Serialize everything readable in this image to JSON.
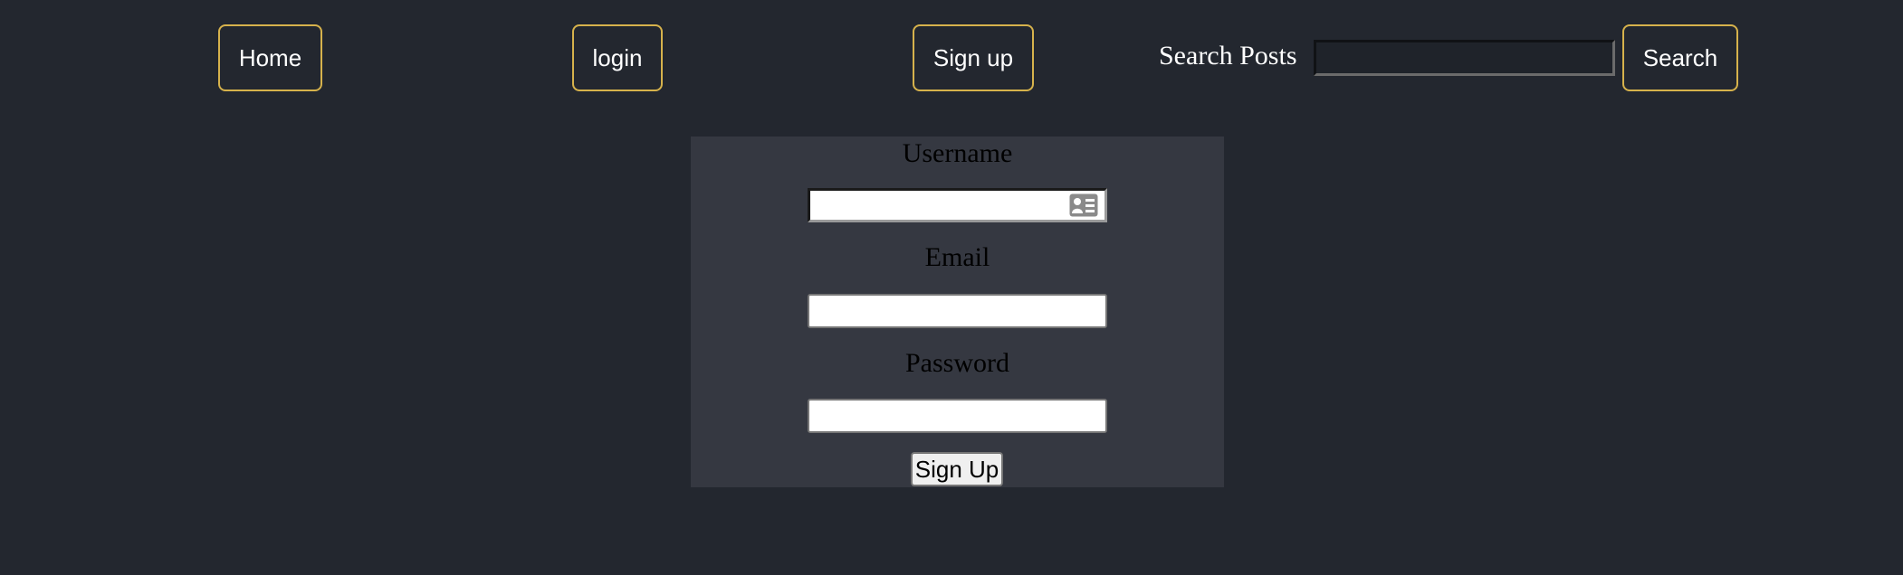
{
  "nav": {
    "home_label": "Home",
    "login_label": "login",
    "signup_label": "Sign up",
    "search_label": "Search Posts",
    "search_input_value": "",
    "search_button_label": "Search"
  },
  "form": {
    "username_label": "Username",
    "username_value": "",
    "email_label": "Email",
    "email_value": "",
    "password_label": "Password",
    "password_value": "",
    "submit_label": "Sign Up"
  },
  "icons": {
    "autofill": "contact-card-icon"
  },
  "colors": {
    "background": "#23272f",
    "panel": "#353841",
    "nav_border": "#d6b24c",
    "nav_text": "#ffffff"
  }
}
